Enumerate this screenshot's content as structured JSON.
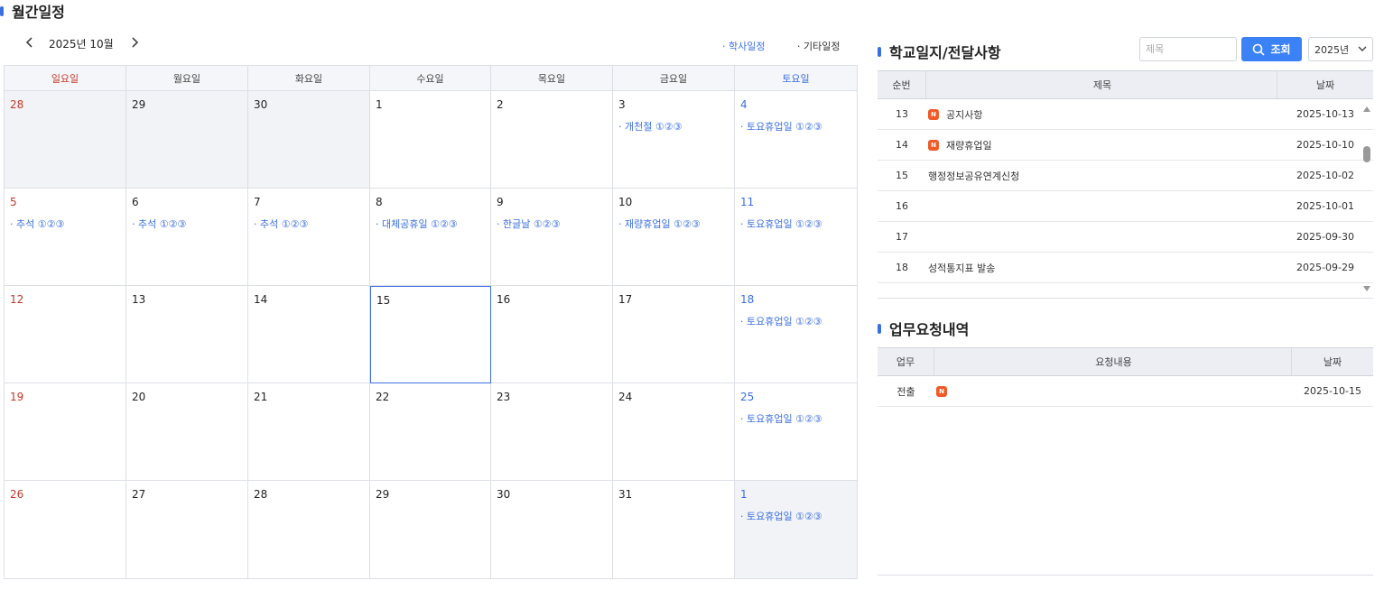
{
  "calendar_section": {
    "title": "월간일정",
    "month_label": "2025년 10월",
    "legend_academic": "· 학사일정",
    "legend_other": "· 기타일정",
    "weekdays": [
      "일요일",
      "월요일",
      "화요일",
      "수요일",
      "목요일",
      "금요일",
      "토요일"
    ],
    "weeks": [
      [
        {
          "day": "28",
          "outside": true,
          "events": []
        },
        {
          "day": "29",
          "outside": true,
          "events": []
        },
        {
          "day": "30",
          "outside": true,
          "events": []
        },
        {
          "day": "1",
          "events": []
        },
        {
          "day": "2",
          "events": []
        },
        {
          "day": "3",
          "events": [
            "· 개천절 ①②③"
          ]
        },
        {
          "day": "4",
          "events": [
            "· 토요휴업일 ①②③"
          ]
        }
      ],
      [
        {
          "day": "5",
          "events": [
            "· 추석 ①②③"
          ]
        },
        {
          "day": "6",
          "events": [
            "· 추석 ①②③"
          ]
        },
        {
          "day": "7",
          "events": [
            "· 추석 ①②③"
          ]
        },
        {
          "day": "8",
          "events": [
            "· 대체공휴일 ①②③"
          ]
        },
        {
          "day": "9",
          "events": [
            "· 한글날 ①②③"
          ]
        },
        {
          "day": "10",
          "events": [
            "· 재량휴업일 ①②③"
          ]
        },
        {
          "day": "11",
          "events": [
            "· 토요휴업일 ①②③"
          ]
        }
      ],
      [
        {
          "day": "12",
          "events": []
        },
        {
          "day": "13",
          "events": []
        },
        {
          "day": "14",
          "events": []
        },
        {
          "day": "15",
          "today": true,
          "events": []
        },
        {
          "day": "16",
          "events": []
        },
        {
          "day": "17",
          "events": []
        },
        {
          "day": "18",
          "events": [
            "· 토요휴업일 ①②③"
          ]
        }
      ],
      [
        {
          "day": "19",
          "events": []
        },
        {
          "day": "20",
          "events": []
        },
        {
          "day": "21",
          "events": []
        },
        {
          "day": "22",
          "events": []
        },
        {
          "day": "23",
          "events": []
        },
        {
          "day": "24",
          "events": []
        },
        {
          "day": "25",
          "events": [
            "· 토요휴업일 ①②③"
          ]
        }
      ],
      [
        {
          "day": "26",
          "events": []
        },
        {
          "day": "27",
          "events": []
        },
        {
          "day": "28",
          "events": []
        },
        {
          "day": "29",
          "events": []
        },
        {
          "day": "30",
          "events": []
        },
        {
          "day": "31",
          "events": []
        },
        {
          "day": "1",
          "outside": true,
          "events": [
            "· 토요휴업일 ①②③"
          ]
        }
      ]
    ]
  },
  "school_log": {
    "title": "학교일지/전달사항",
    "search_placeholder": "제목",
    "search_button": "조회",
    "year": "2025년",
    "headers": {
      "no": "순번",
      "title": "제목",
      "date": "날짜"
    },
    "rows": [
      {
        "no": "13",
        "badge": "N",
        "title": "공지사항",
        "date": "2025-10-13"
      },
      {
        "no": "14",
        "badge": "N",
        "title": "재량휴업일",
        "date": "2025-10-10"
      },
      {
        "no": "15",
        "badge": "",
        "title": "행정정보공유연계신청",
        "date": "2025-10-02"
      },
      {
        "no": "16",
        "badge": "",
        "title": "",
        "date": "2025-10-01"
      },
      {
        "no": "17",
        "badge": "",
        "title": "",
        "date": "2025-09-30"
      },
      {
        "no": "18",
        "badge": "",
        "title": "성적통지표 발송",
        "date": "2025-09-29"
      }
    ]
  },
  "work_requests": {
    "title": "업무요청내역",
    "headers": {
      "type": "업무",
      "content": "요청내용",
      "date": "날짜"
    },
    "rows": [
      {
        "type": "전출",
        "badge": "N",
        "content": "",
        "date": "2025-10-15"
      }
    ]
  },
  "icons": {
    "prev": "chevron-left-icon",
    "next": "chevron-right-icon",
    "search": "search-icon",
    "dropdown": "chevron-down-icon",
    "new_badge": "new-badge-icon"
  },
  "colors": {
    "accent": "#3b6fe0",
    "button": "#3b82f6",
    "sunday": "#c0392b",
    "new_badge": "#f05a28"
  }
}
